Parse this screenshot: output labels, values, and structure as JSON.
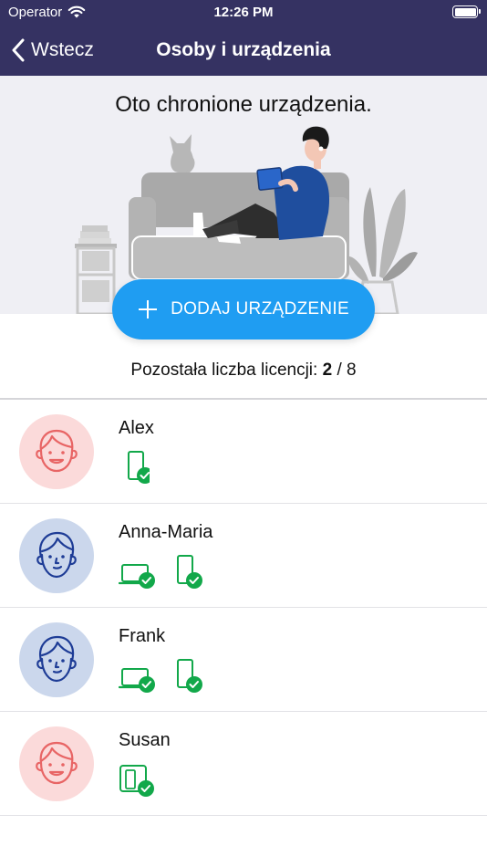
{
  "status_bar": {
    "carrier": "Operator",
    "time": "12:26 PM"
  },
  "nav": {
    "back_label": "Wstecz",
    "title": "Osoby i urządzenia"
  },
  "hero": {
    "title": "Oto chronione urządzenia."
  },
  "add_device": {
    "label": "DODAJ URZĄDZENIE"
  },
  "license": {
    "label": "Pozostała liczba licencji:",
    "remaining": "2",
    "separator": "/",
    "total": "8"
  },
  "colors": {
    "nav_bg": "#353262",
    "accent": "#1f9df2",
    "device_green": "#12a84a",
    "avatar_pink": "#fbdada",
    "avatar_blue": "#cbd7ec"
  },
  "people": [
    {
      "name": "Alex",
      "avatar": "pink",
      "devices": [
        "phone"
      ]
    },
    {
      "name": "Anna-Maria",
      "avatar": "blue",
      "devices": [
        "laptop",
        "phone"
      ]
    },
    {
      "name": "Frank",
      "avatar": "blue",
      "devices": [
        "laptop",
        "phone"
      ]
    },
    {
      "name": "Susan",
      "avatar": "pink",
      "devices": [
        "tablet"
      ]
    }
  ]
}
